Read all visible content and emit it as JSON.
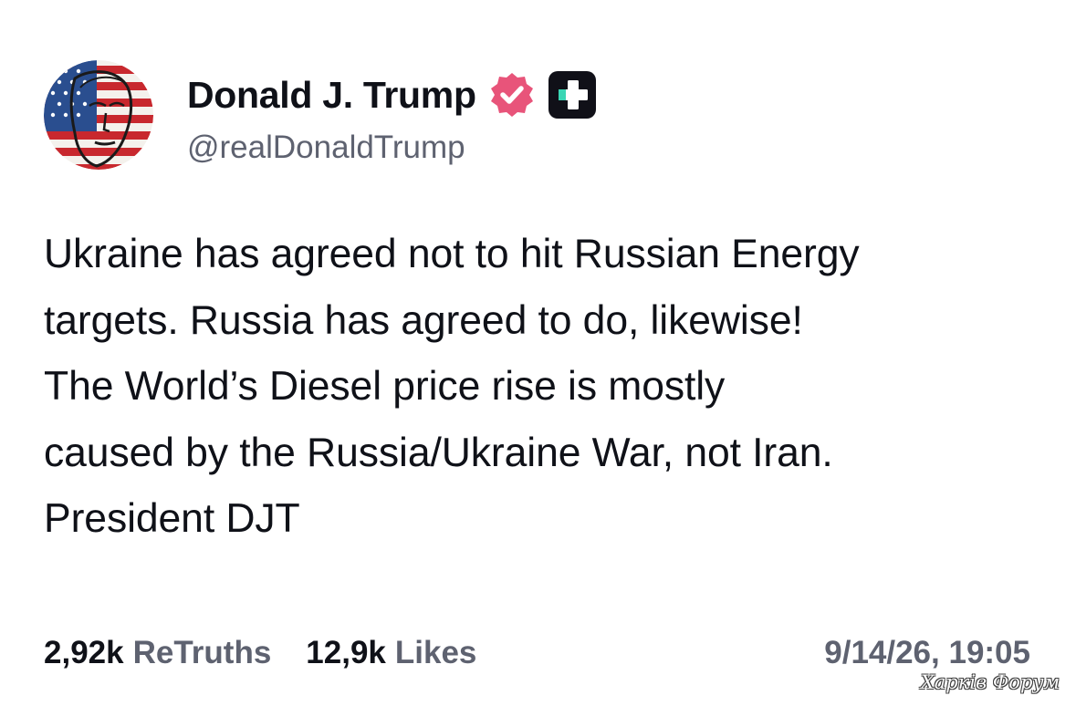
{
  "author": {
    "display_name": "Donald J. Trump",
    "handle": "@realDonaldTrump",
    "avatar_icon": "avatar-flag-portrait",
    "verified_icon": "verified-badge-icon",
    "verified_color": "#e8547a",
    "plus_icon": "truth-plus-icon"
  },
  "post": {
    "lines": [
      "Ukraine has agreed not to hit Russian Energy",
      "targets. Russia has agreed to do, likewise!",
      "The World’s Diesel price rise is mostly",
      "caused by the Russia/Ukraine War, not Iran.",
      "President DJT"
    ]
  },
  "stats": {
    "retruths_count": "2,92k",
    "retruths_label": "ReTruths",
    "likes_count": "12,9k",
    "likes_label": "Likes",
    "timestamp": "9/14/26, 19:05"
  },
  "watermark": {
    "text": "Харків Форум"
  }
}
